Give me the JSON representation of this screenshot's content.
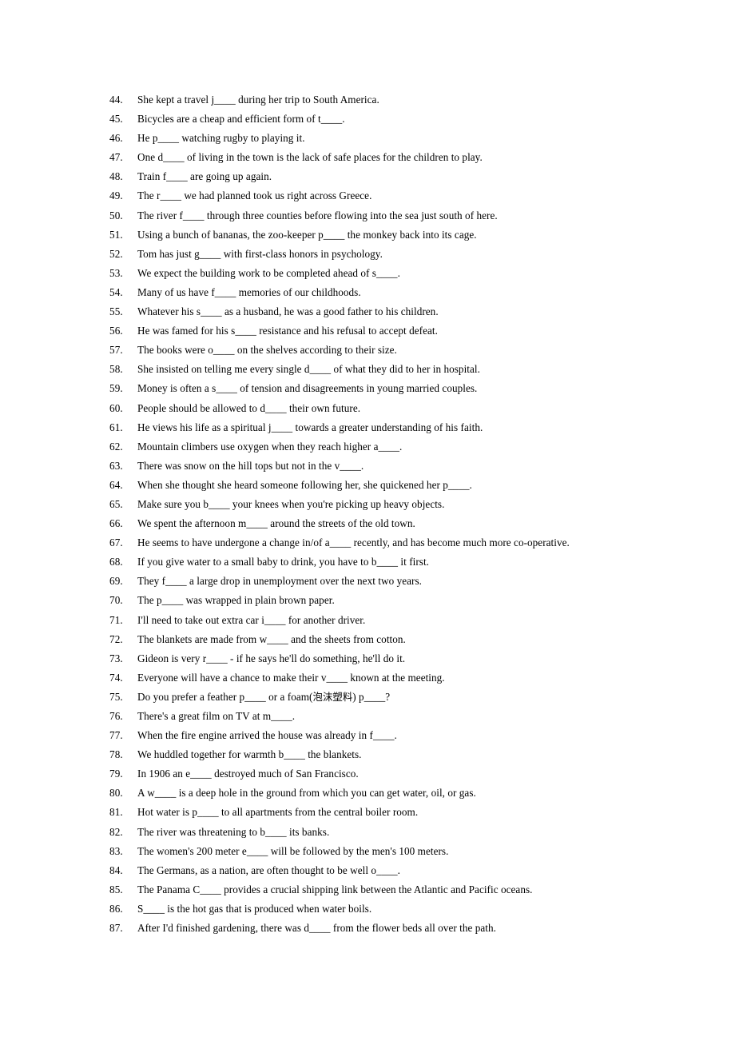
{
  "document": {
    "type": "vocabulary-gap-fill-worksheet",
    "page_background": "#ffffff",
    "text_color": "#000000"
  },
  "exercises": [
    {
      "number": "44.",
      "text": "She kept a travel j____ during her trip to South America."
    },
    {
      "number": "45.",
      "text": "Bicycles are a cheap and efficient form of t____."
    },
    {
      "number": "46.",
      "text": "He p____ watching rugby to playing it."
    },
    {
      "number": "47.",
      "text": "One d____ of living in the town is the lack of safe places for the children to play."
    },
    {
      "number": "48.",
      "text": "Train f____ are going up again."
    },
    {
      "number": "49.",
      "text": "The r____ we had planned took us right across Greece."
    },
    {
      "number": "50.",
      "text": "The river f____ through three counties before flowing into the sea just south of here."
    },
    {
      "number": "51.",
      "text": "Using a bunch of bananas, the zoo-keeper p____ the monkey back into its cage."
    },
    {
      "number": "52.",
      "text": "Tom has just g____ with first-class honors in psychology."
    },
    {
      "number": "53.",
      "text": "We expect the building work to be completed ahead of s____."
    },
    {
      "number": "54.",
      "text": "Many of us have f____ memories of our childhoods."
    },
    {
      "number": "55.",
      "text": "Whatever his s____ as a husband, he was a good father to his children."
    },
    {
      "number": "56.",
      "text": "He was famed for his s____ resistance and his refusal to accept defeat."
    },
    {
      "number": "57.",
      "text": "The books were o____ on the shelves according to their size."
    },
    {
      "number": "58.",
      "text": "She insisted on telling me every single d____ of what they did to her in hospital."
    },
    {
      "number": "59.",
      "text": "Money is often a s____ of tension and disagreements in young married couples."
    },
    {
      "number": "60.",
      "text": "People should be allowed to d____ their own future."
    },
    {
      "number": "61.",
      "text": "He views his life as a spiritual j____ towards a greater understanding of his faith."
    },
    {
      "number": "62.",
      "text": "Mountain climbers use oxygen when they reach higher a____."
    },
    {
      "number": "63.",
      "text": "There was snow on the hill tops but not in the v____."
    },
    {
      "number": "64.",
      "text": "When she thought she heard someone following her, she quickened her p____."
    },
    {
      "number": "65.",
      "text": "Make sure you b____ your knees when you're picking up heavy objects."
    },
    {
      "number": "66.",
      "text": "We spent the afternoon m____ around the streets of the old town."
    },
    {
      "number": "67.",
      "text": "He seems to have undergone a change in/of a____ recently, and has become much more co-operative."
    },
    {
      "number": "68.",
      "text": "If you give water to a small baby to drink, you have to b____ it first."
    },
    {
      "number": "69.",
      "text": "They f____ a large drop in unemployment over the next two years."
    },
    {
      "number": "70.",
      "text": "The p____ was wrapped in plain brown paper."
    },
    {
      "number": "71.",
      "text": "I'll need to take out extra car i____ for another driver."
    },
    {
      "number": "72.",
      "text": "The blankets are made from w____ and the sheets from cotton."
    },
    {
      "number": "73.",
      "text": "Gideon is very r____ - if he says he'll do something, he'll do it."
    },
    {
      "number": "74.",
      "text": "Everyone will have a chance to make their v____ known at the meeting."
    },
    {
      "number": "75.",
      "text": "Do you prefer a feather p____ or a foam(泡沫塑料) p____?"
    },
    {
      "number": "76.",
      "text": "There's a great film on TV at m____."
    },
    {
      "number": "77.",
      "text": "When the fire engine arrived the house was already in f____."
    },
    {
      "number": "78.",
      "text": "We huddled together for warmth b____ the blankets."
    },
    {
      "number": "79.",
      "text": "In 1906 an e____ destroyed much of San Francisco."
    },
    {
      "number": "80.",
      "text": "A w____ is a deep hole in the ground from which you can get water, oil, or gas."
    },
    {
      "number": "81.",
      "text": "Hot water is p____ to all apartments from the central boiler room."
    },
    {
      "number": "82.",
      "text": "The river was threatening to b____ its banks."
    },
    {
      "number": "83.",
      "text": "The women's 200 meter e____ will be followed by the men's 100 meters."
    },
    {
      "number": "84.",
      "text": "The Germans, as a nation, are often thought to be well o____."
    },
    {
      "number": "85.",
      "text": "The Panama C____ provides a crucial shipping link between the Atlantic and Pacific oceans."
    },
    {
      "number": "86.",
      "text": "S____ is the hot gas that is produced when water boils."
    },
    {
      "number": "87.",
      "text": "After I'd finished gardening, there was d____ from the flower beds all over the path."
    }
  ]
}
